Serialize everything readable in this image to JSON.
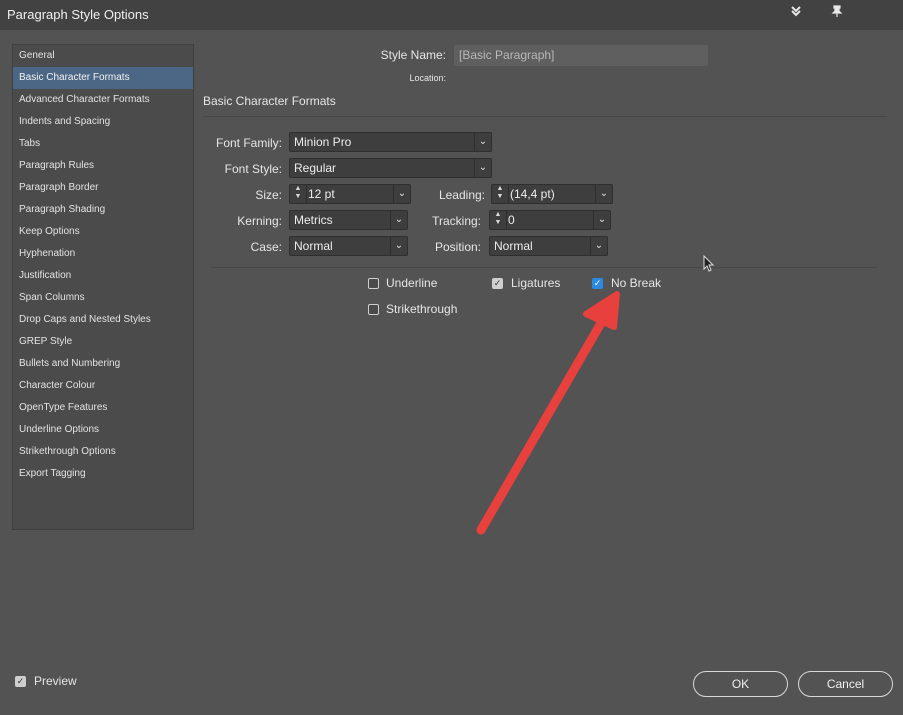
{
  "window": {
    "title": "Paragraph Style Options",
    "icons": [
      "collapse-icon",
      "pin-icon"
    ]
  },
  "sidebar": {
    "items": [
      {
        "label": "General"
      },
      {
        "label": "Basic Character Formats",
        "selected": true
      },
      {
        "label": "Advanced Character Formats"
      },
      {
        "label": "Indents and Spacing"
      },
      {
        "label": "Tabs"
      },
      {
        "label": "Paragraph Rules"
      },
      {
        "label": "Paragraph Border"
      },
      {
        "label": "Paragraph Shading"
      },
      {
        "label": "Keep Options"
      },
      {
        "label": "Hyphenation"
      },
      {
        "label": "Justification"
      },
      {
        "label": "Span Columns"
      },
      {
        "label": "Drop Caps and Nested Styles"
      },
      {
        "label": "GREP Style"
      },
      {
        "label": "Bullets and Numbering"
      },
      {
        "label": "Character Colour"
      },
      {
        "label": "OpenType Features"
      },
      {
        "label": "Underline Options"
      },
      {
        "label": "Strikethrough Options"
      },
      {
        "label": "Export Tagging"
      }
    ]
  },
  "header": {
    "style_name_label": "Style Name:",
    "style_name_value": "[Basic Paragraph]",
    "location_label": "Location:",
    "section_title": "Basic Character Formats"
  },
  "form": {
    "font_family_label": "Font Family:",
    "font_family_value": "Minion Pro",
    "font_style_label": "Font Style:",
    "font_style_value": "Regular",
    "size_label": "Size:",
    "size_value": "12 pt",
    "leading_label": "Leading:",
    "leading_value": "(14,4 pt)",
    "kerning_label": "Kerning:",
    "kerning_value": "Metrics",
    "tracking_label": "Tracking:",
    "tracking_value": "0",
    "case_label": "Case:",
    "case_value": "Normal",
    "position_label": "Position:",
    "position_value": "Normal"
  },
  "checkboxes": {
    "underline": {
      "label": "Underline",
      "checked": false
    },
    "ligatures": {
      "label": "Ligatures",
      "checked": true
    },
    "no_break": {
      "label": "No Break",
      "checked": true
    },
    "strikethrough": {
      "label": "Strikethrough",
      "checked": false
    }
  },
  "footer": {
    "preview_label": "Preview",
    "preview_checked": true,
    "ok_label": "OK",
    "cancel_label": "Cancel"
  },
  "annotation": {
    "arrow_color": "#e8413d"
  }
}
